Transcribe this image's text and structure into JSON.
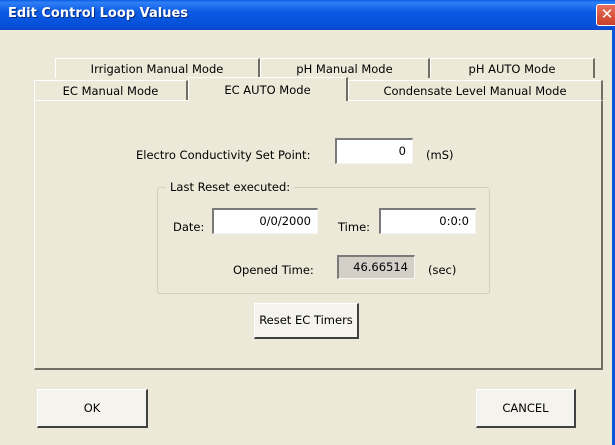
{
  "window": {
    "title": "Edit Control Loop Values",
    "close_glyph": "✕"
  },
  "tabs": {
    "row_back": [
      {
        "label": "Irrigation Manual Mode"
      },
      {
        "label": "pH Manual Mode"
      },
      {
        "label": "pH AUTO Mode"
      }
    ],
    "row_front": [
      {
        "label": "EC Manual Mode"
      },
      {
        "label": "EC AUTO Mode",
        "selected": true
      },
      {
        "label": "Condensate Level Manual Mode"
      }
    ]
  },
  "ec_auto": {
    "setpoint_label": "Electro Conductivity Set Point:",
    "setpoint_value": "0",
    "setpoint_unit": "(mS)",
    "last_reset": {
      "group_title": "Last Reset executed:",
      "date_label": "Date:",
      "date_value": "0/0/2000",
      "time_label": "Time:",
      "time_value": "0:0:0",
      "opened_label": "Opened Time:",
      "opened_value": "46.66514",
      "opened_unit": "(sec)"
    },
    "reset_button": "Reset EC Timers"
  },
  "footer": {
    "ok_label": "OK",
    "cancel_label": "CANCEL"
  }
}
